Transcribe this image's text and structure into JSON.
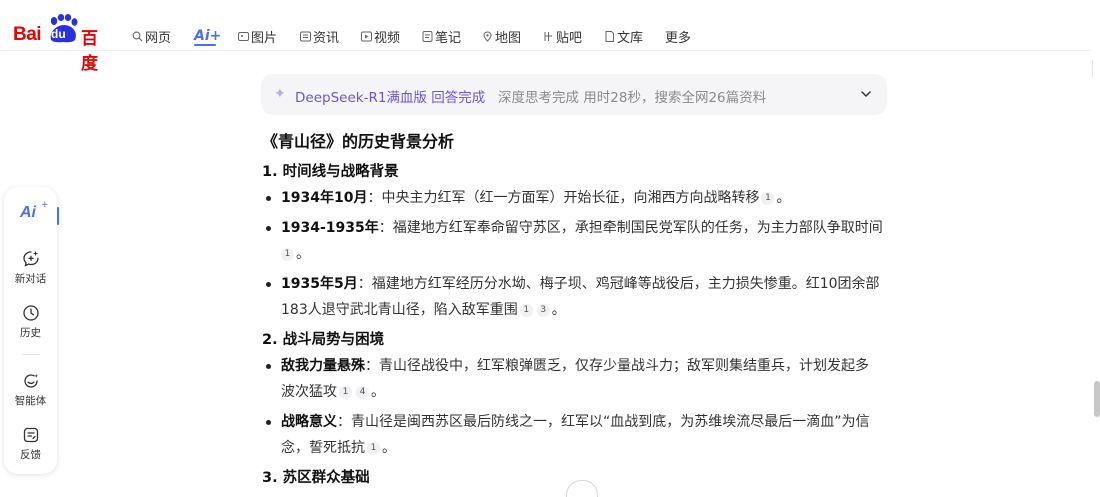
{
  "brand": {
    "logo_text_latin": "Bai",
    "logo_text_du": "du",
    "logo_text_cn": "百度"
  },
  "nav": {
    "items": [
      {
        "label": "网页",
        "icon": "search-icon"
      },
      {
        "label": "Ai+",
        "icon": "ai-plus-icon",
        "active": true
      },
      {
        "label": "图片",
        "icon": "image-icon"
      },
      {
        "label": "资讯",
        "icon": "news-icon"
      },
      {
        "label": "视频",
        "icon": "video-icon"
      },
      {
        "label": "笔记",
        "icon": "note-icon"
      },
      {
        "label": "地图",
        "icon": "map-icon"
      },
      {
        "label": "贴吧",
        "icon": "tieba-icon"
      },
      {
        "label": "文库",
        "icon": "library-icon"
      },
      {
        "label": "更多",
        "icon": ""
      }
    ],
    "accent": "#4e6ef2"
  },
  "sidebar": {
    "ai_label": "Ai",
    "ai_star": "+",
    "items": [
      {
        "label": "新对话",
        "icon": "new-chat-icon"
      },
      {
        "label": "历史",
        "icon": "history-clock-icon"
      },
      {
        "label": "智能体",
        "icon": "agent-icon"
      },
      {
        "label": "反馈",
        "icon": "feedback-icon"
      }
    ]
  },
  "status": {
    "model": "DeepSeek-R1满血版 回答完成",
    "meta": "深度思考完成 用时28秒，搜索全网26篇资料",
    "model_color": "#6c55d8"
  },
  "article": {
    "title": "《青山径》的历史背景分析",
    "sections": [
      {
        "heading": "1. 时间线与战略背景",
        "bullets": [
          {
            "term": "1934年10月",
            "lines": [
              "：中央主力红军（红一方面军）开始长征，向湘西方向战略转移"
            ],
            "cites": [
              "1"
            ],
            "tail": "。"
          },
          {
            "term": "1934-1935年",
            "lines": [
              "：福建地方红军奉命留守苏区，承担牵制国民党军队的任务，为主力部队争取时间"
            ],
            "cites": [
              "1"
            ],
            "tail": "。"
          },
          {
            "term": "1935年5月",
            "lines": [
              "：福建地方红军经历分水坳、梅子坝、鸡冠峰等战役后，主力损失惨重。红10团余部",
              "183人退守武北青山径，陷入敌军重围"
            ],
            "cites": [
              "1",
              "3"
            ],
            "tail": "。"
          }
        ]
      },
      {
        "heading": "2. 战斗局势与困境",
        "bullets": [
          {
            "term": "敌我力量悬殊",
            "lines": [
              "：青山径战役中，红军粮弹匮乏，仅存少量战斗力；敌军则集结重兵，计划发起多",
              "波次猛攻"
            ],
            "cites": [
              "1",
              "4"
            ],
            "tail": "。"
          },
          {
            "term": "战略意义",
            "lines": [
              "：青山径是闽西苏区最后防线之一，红军以“血战到底，为苏维埃流尽最后一滴血”为信",
              "念，誓死抵抗"
            ],
            "cites": [
              "1"
            ],
            "tail": "。"
          }
        ]
      },
      {
        "heading": "3. 苏区群众基础",
        "bullets": []
      }
    ]
  }
}
